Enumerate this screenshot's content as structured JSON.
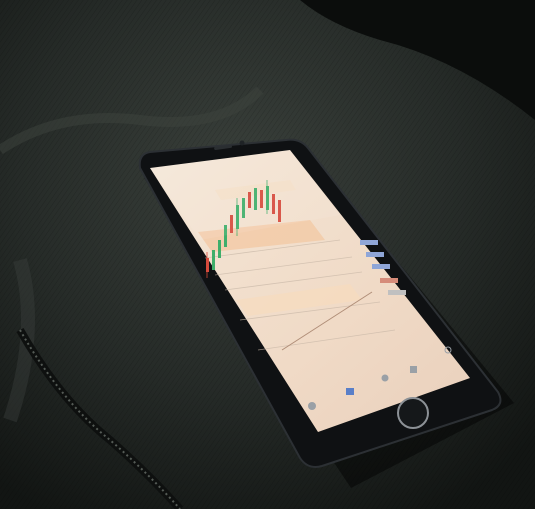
{
  "scene": {
    "subject": "smartphone-on-fabric",
    "colors": {
      "fabric_dark": "#1c201e",
      "fabric_mid": "#2b302c",
      "phone_body": "#101214",
      "screen_bg": "#f1e2d2",
      "candle_up": "#3fae6a",
      "candle_down": "#d64a3c",
      "zone_band": "#f3c9a5",
      "home_button": "#8c9196"
    },
    "icons": [
      "home-icon",
      "chart-icon",
      "trade-icon",
      "settings-icon"
    ]
  }
}
